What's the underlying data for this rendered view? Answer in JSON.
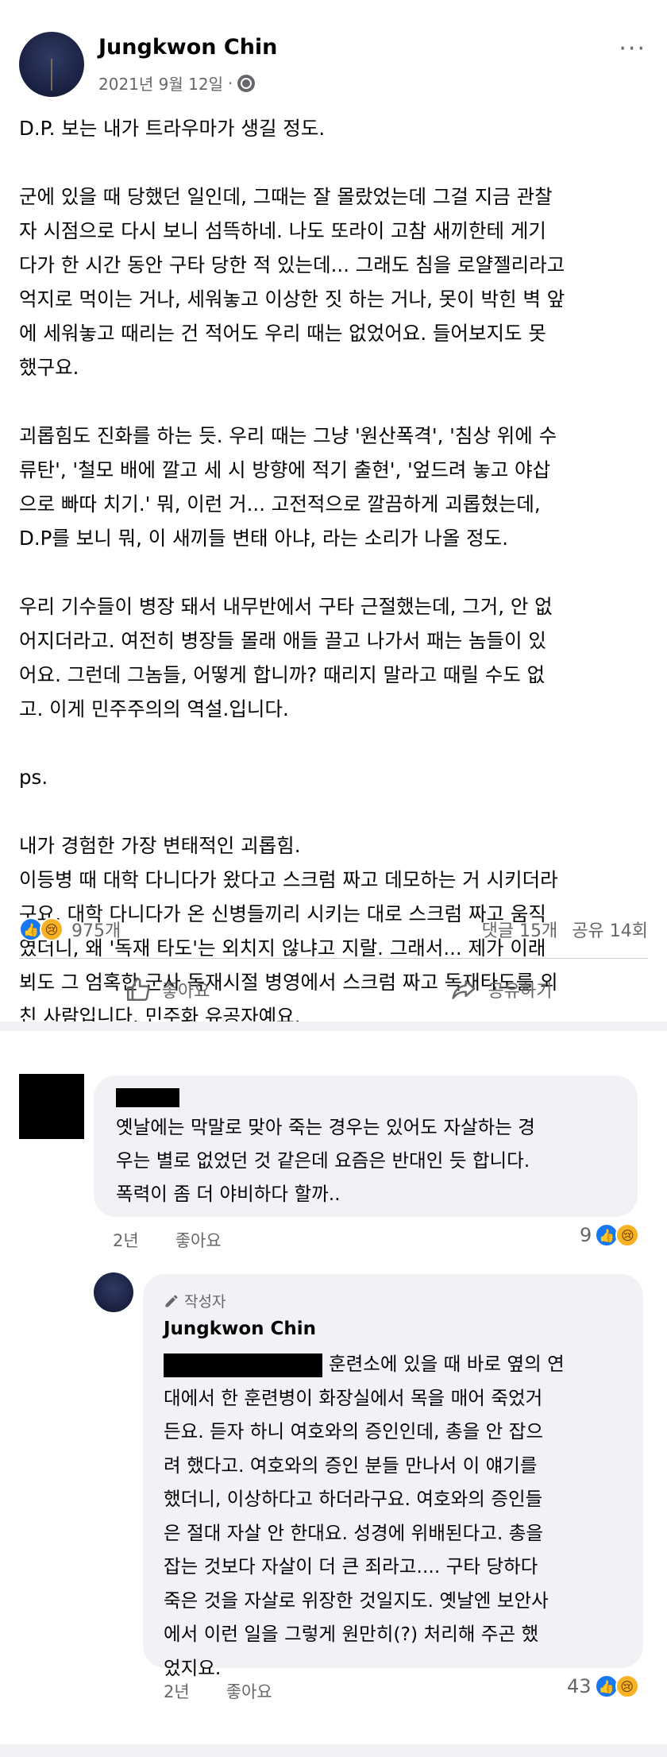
{
  "post": {
    "author": "Jungkwon Chin",
    "date": "2021년 9월 12일",
    "separator": "·",
    "more": "···",
    "paragraphs": [
      "D.P. 보는 내가 트라우마가 생길 정도.",
      "군에 있을 때 당했던 일인데, 그때는 잘 몰랐었는데 그걸 지금 관찰\n자 시점으로 다시 보니 섬뜩하네. 나도 또라이 고참 새끼한테 게기\n다가 한 시간 동안 구타 당한 적 있는데... 그래도 침을 로얄젤리라고\n억지로 먹이는 거나, 세워놓고 이상한 짓 하는 거나, 못이 박힌 벽 앞\n에 세워놓고 때리는 건 적어도 우리 때는 없었어요. 들어보지도 못\n했구요.",
      "괴롭힘도 진화를 하는 듯. 우리 때는 그냥 '원산폭격', '침상 위에 수\n류탄', '철모 배에 깔고 세 시 방향에 적기 출현', '엎드려 놓고 야삽\n으로 빠따 치기.'  뭐, 이런 거...  고전적으로 깔끔하게 괴롭혔는데,\nD.P를 보니 뭐, 이 새끼들 변태 아냐, 라는 소리가 나올 정도.",
      "우리 기수들이 병장 돼서 내무반에서 구타 근절했는데, 그거, 안 없\n어지더라고. 여전히 병장들 몰래 애들 끌고 나가서 패는 놈들이 있\n어요. 그런데 그놈들, 어떻게 합니까? 때리지 말라고 때릴 수도 없\n고. 이게 민주주의의 역설.입니다.",
      "ps.",
      "내가 경험한 가장 변태적인 괴롭힘.\n이등병 때 대학 다니다가 왔다고 스크럼 짜고 데모하는 거 시키더라\n구요. 대학 다니다가 온 신병들끼리 시키는 대로 스크럼 짜고 움직\n였더니, 왜 '독재 타도'는 외치지 않냐고 지랄. 그래서... 제가 이래\n뵈도 그 엄혹한 군사 독재시절 병영에서 스크럼 짜고 독재타도를 외\n친 사람입니다. 민주화 유공자예요."
    ],
    "reaction_count": "975개",
    "comment_count": "댓글 15개",
    "share_count": "공유 14회",
    "like_label": "좋아요",
    "share_label": "공유하기"
  },
  "comments": [
    {
      "text": "옛날에는 막말로 맞아 죽는 경우는 있어도 자살하는 경\n우는 별로 없었던 것 같은데 요즘은 반대인 듯 합니다.\n폭력이 좀 더 야비하다 할까..",
      "time": "2년",
      "like_label": "좋아요",
      "reaction_count": "9"
    },
    {
      "badge": "작성자",
      "author": "Jungkwon Chin",
      "text": "훈련소에 있을 때 바로 옆의 연\n대에서 한 훈련병이 화장실에서 목을 매어 죽었거\n든요. 듣자 하니 여호와의 증인인데, 총을 안 잡으\n려 했다고. 여호와의 증인 분들 만나서 이 얘기를\n했더니, 이상하다고 하더라구요. 여호와의 증인들\n은 절대 자살 안 한대요. 성경에 위배된다고. 총을\n잡는 것보다 자살이 더 큰 죄라고.... 구타 당하다\n죽은 것을 자살로 위장한 것일지도. 옛날엔 보안사\n에서 이런 일을 그렇게 원만히(?) 처리해 주곤 했\n었지요.",
      "time": "2년",
      "like_label": "좋아요",
      "reaction_count": "43"
    }
  ],
  "icons": {
    "like": "like-icon",
    "sad": "sad-icon",
    "share": "share-icon",
    "globe": "globe-icon",
    "pencil": "pencil-icon"
  },
  "colors": {
    "like_blue": "#1877f2",
    "sad_yellow": "#f7b125",
    "muted": "#65676b",
    "bubble": "#f0f2f5"
  }
}
